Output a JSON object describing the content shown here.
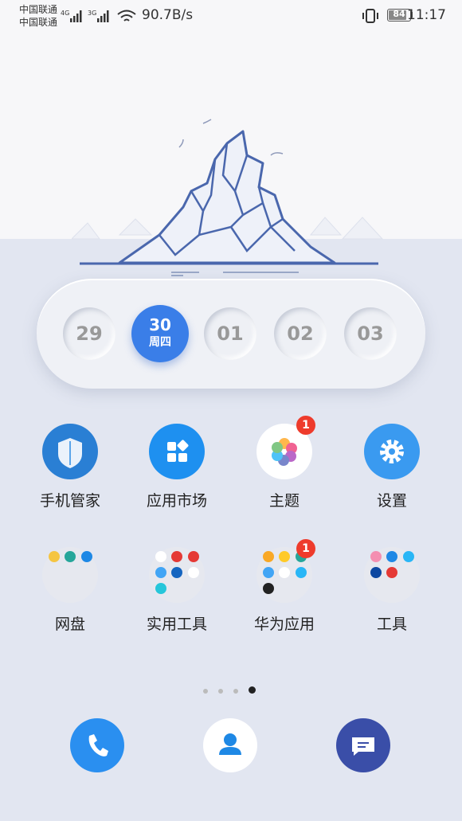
{
  "status_bar": {
    "carrier_1": "中国联通",
    "carrier_2": "中国联通",
    "net_1": "4G",
    "net_2": "3G",
    "speed": "90.7B/s",
    "battery": "84",
    "time": "11:17"
  },
  "calendar": {
    "days": [
      "29",
      "30",
      "01",
      "02",
      "03"
    ],
    "active_weekday": "周四"
  },
  "apps": [
    {
      "label": "手机管家",
      "color": "#2a7fd4"
    },
    {
      "label": "应用市场",
      "color": "#1e90f0"
    },
    {
      "label": "主题",
      "color": "#ffffff",
      "badge": "1"
    },
    {
      "label": "设置",
      "color": "#3a9af0"
    }
  ],
  "folders": [
    {
      "label": "网盘"
    },
    {
      "label": "实用工具"
    },
    {
      "label": "华为应用",
      "badge": "1"
    },
    {
      "label": "工具"
    }
  ],
  "page_indicator": {
    "count": 4,
    "active": 4
  },
  "dock": [
    {
      "icon": "phone-icon",
      "color": "#2a8ff0"
    },
    {
      "icon": "contacts-icon",
      "color": "#ffffff"
    },
    {
      "icon": "messages-icon",
      "color": "#3a4ea8"
    }
  ]
}
